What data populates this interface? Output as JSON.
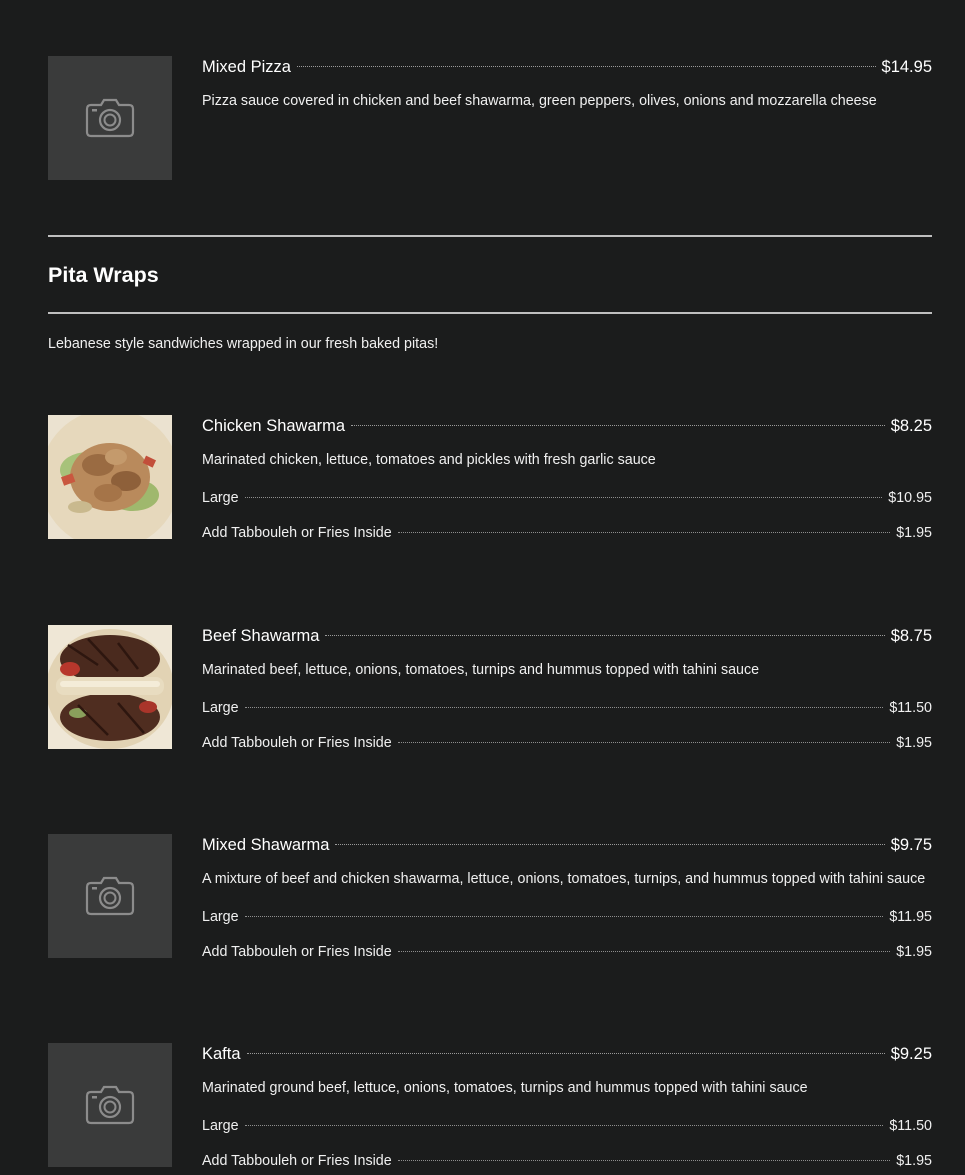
{
  "top_item": {
    "name": "Mixed Pizza",
    "price": "$14.95",
    "description": "Pizza sauce covered in chicken and beef shawarma, green peppers, olives, onions and mozzarella cheese",
    "icon": "camera-icon"
  },
  "section": {
    "title": "Pita Wraps",
    "description": "Lebanese style sandwiches wrapped in our fresh baked pitas!"
  },
  "items": [
    {
      "name": "Chicken Shawarma",
      "price": "$8.25",
      "description": "Marinated chicken, lettuce, tomatoes and pickles with fresh garlic sauce",
      "options": [
        {
          "label": "Large",
          "price": "$10.95"
        },
        {
          "label": "Add Tabbouleh or Fries Inside",
          "price": "$1.95"
        }
      ]
    },
    {
      "name": "Beef Shawarma",
      "price": "$8.75",
      "description": "Marinated beef, lettuce, onions, tomatoes, turnips and hummus topped with tahini sauce",
      "options": [
        {
          "label": "Large",
          "price": "$11.50"
        },
        {
          "label": "Add Tabbouleh or Fries Inside",
          "price": "$1.95"
        }
      ]
    },
    {
      "name": "Mixed Shawarma",
      "price": "$9.75",
      "description": "A mixture of beef and chicken shawarma, lettuce, onions, tomatoes, turnips, and hummus topped with tahini sauce",
      "icon": "camera-icon",
      "options": [
        {
          "label": "Large",
          "price": "$11.95"
        },
        {
          "label": "Add Tabbouleh or Fries Inside",
          "price": "$1.95"
        }
      ]
    },
    {
      "name": "Kafta",
      "price": "$9.25",
      "description": "Marinated ground beef, lettuce, onions, tomatoes, turnips and hummus topped with tahini sauce",
      "icon": "camera-icon",
      "options": [
        {
          "label": "Large",
          "price": "$11.50"
        },
        {
          "label": "Add Tabbouleh or Fries Inside",
          "price": "$1.95"
        }
      ]
    }
  ],
  "colors": {
    "background": "#1b1c1c",
    "placeholder": "#3a3b3b",
    "text": "#ffffff",
    "rule": "#bfbfbf"
  }
}
